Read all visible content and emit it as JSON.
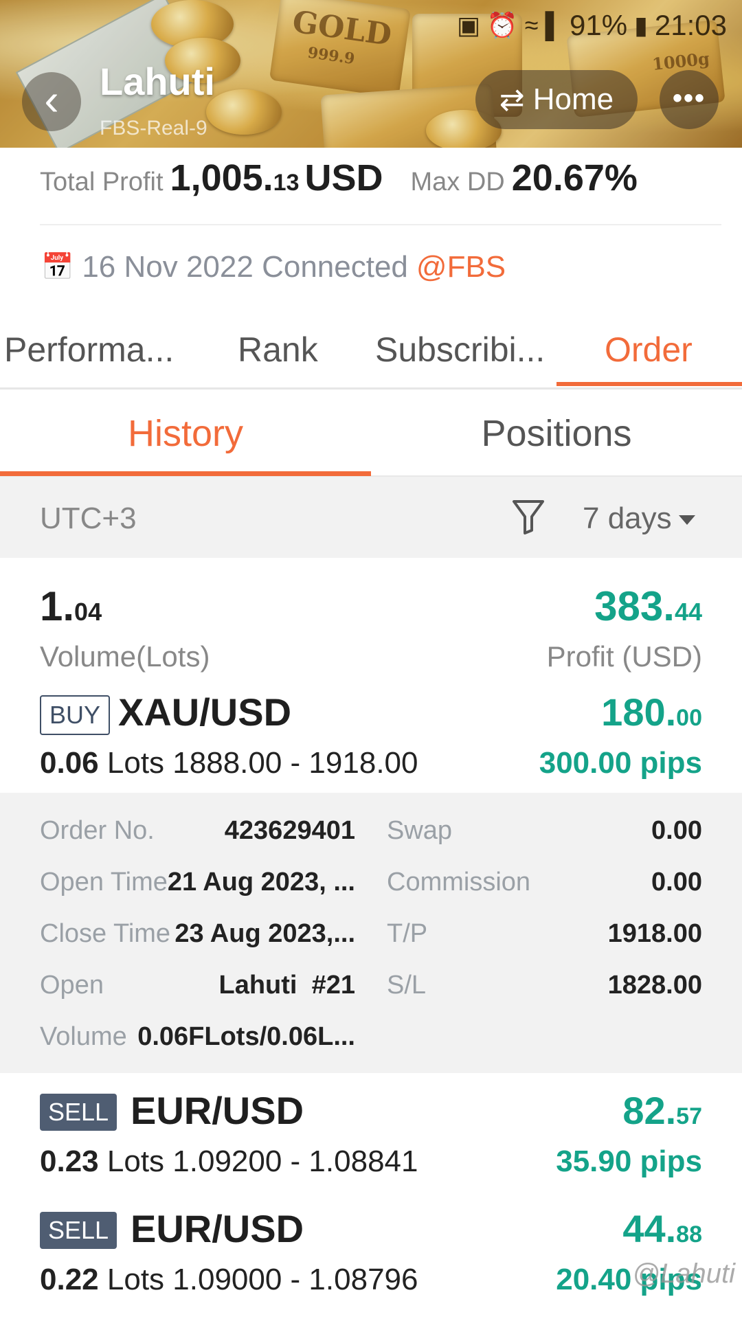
{
  "status_bar": {
    "battery": "91%",
    "time": "21:03",
    "icons": [
      "battery-saver-icon",
      "alarm-icon",
      "wifi-icon",
      "signal-icon",
      "battery-icon"
    ]
  },
  "header": {
    "title": "Lahuti",
    "subtitle": "FBS-Real-9",
    "home_label": "Home",
    "back_icon": "back-chevron-icon",
    "swap_icon": "swap-arrows-icon",
    "more_icon": "more-dots-icon"
  },
  "summary": {
    "total_profit_label": "Total Profit",
    "total_profit_int": "1,005.",
    "total_profit_dec": "13",
    "currency": "USD",
    "max_dd_label": "Max DD",
    "max_dd_value": "20.67%"
  },
  "connection": {
    "date_text": "16 Nov 2022 Connected",
    "broker": "@FBS"
  },
  "main_tabs": [
    "Performa...",
    "Rank",
    "Subscribi...",
    "Order"
  ],
  "main_tab_active": "Order",
  "sub_tabs": [
    "History",
    "Positions"
  ],
  "sub_tab_active": "History",
  "filter": {
    "timezone": "UTC+3",
    "period": "7 days"
  },
  "totals": {
    "volume_int": "1.",
    "volume_dec": "04",
    "volume_label": "Volume(Lots)",
    "profit_int": "383.",
    "profit_dec": "44",
    "profit_label": "Profit (USD)"
  },
  "orders": [
    {
      "side": "BUY",
      "symbol": "XAU/USD",
      "lots": "0.06",
      "lots_word": "Lots",
      "prices": "1888.00 - 1918.00",
      "profit_int": "180.",
      "profit_dec": "00",
      "pips": "300.00 pips",
      "details": {
        "order_no_label": "Order No.",
        "order_no": "423629401",
        "swap_label": "Swap",
        "swap": "0.00",
        "open_time_label": "Open Time",
        "open_time": "21 Aug 2023, ...",
        "commission_label": "Commission",
        "commission": "0.00",
        "close_time_label": "Close Time",
        "close_time": "23 Aug 2023,...",
        "tp_label": "T/P",
        "tp": "1918.00",
        "open_label": "Open",
        "open": "Lahuti  #21",
        "sl_label": "S/L",
        "sl": "1828.00",
        "volume_label": "Volume",
        "volume": "0.06FLots/0.06L..."
      }
    },
    {
      "side": "SELL",
      "symbol": "EUR/USD",
      "lots": "0.23",
      "lots_word": "Lots",
      "prices": "1.09200 - 1.08841",
      "profit_int": "82.",
      "profit_dec": "57",
      "pips": "35.90 pips"
    },
    {
      "side": "SELL",
      "symbol": "EUR/USD",
      "lots": "0.22",
      "lots_word": "Lots",
      "prices": "1.09000 - 1.08796",
      "profit_int": "44.",
      "profit_dec": "88",
      "pips": "20.40 pips"
    }
  ],
  "watermark": "@Lahuti",
  "colors": {
    "accent": "#f26b3a",
    "profit_green": "#14a389",
    "sell_badge": "#4f5d72",
    "buy_border": "#3f4f66"
  }
}
